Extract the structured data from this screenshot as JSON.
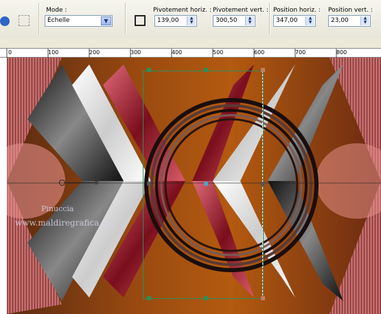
{
  "toolbar": {
    "mode_label": "Mode :",
    "mode_value": "Échelle",
    "fields": [
      {
        "label": "Pivotement horiz. :",
        "value": "139,00"
      },
      {
        "label": "Pivotement vert. :",
        "value": "300,50"
      },
      {
        "label": "Position horiz. :",
        "value": "347,00"
      },
      {
        "label": "Position vert. :",
        "value": "23,00"
      }
    ]
  },
  "ruler": {
    "ticks": [
      "0",
      "100",
      "200",
      "300",
      "400",
      "500",
      "600",
      "700",
      "800"
    ]
  },
  "watermark": {
    "line1": "Pinuccia",
    "line2": "www.maldiregrafica.eu"
  },
  "colors": {
    "background_brown": "#7a3a0a",
    "rose": "#c8404c",
    "dark_red": "#6e0b16",
    "handle_green": "#2d8f5c"
  }
}
